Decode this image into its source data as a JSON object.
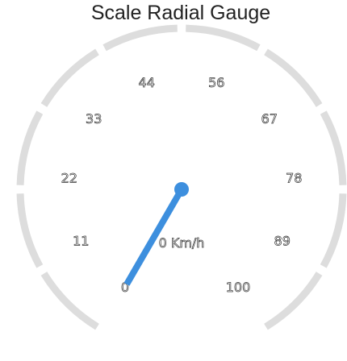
{
  "chart_data": {
    "type": "gauge",
    "title": "Scale Radial Gauge",
    "min": 0,
    "max": 100,
    "value": 0,
    "value_label": "0 Km/h",
    "unit": "Km/h",
    "tick_labels": [
      "0",
      "11",
      "22",
      "33",
      "44",
      "56",
      "67",
      "78",
      "89",
      "100"
    ],
    "segments": 10,
    "colors": {
      "track": "#dddddd",
      "pointer": "#3d8fde",
      "title": "#222222"
    }
  }
}
